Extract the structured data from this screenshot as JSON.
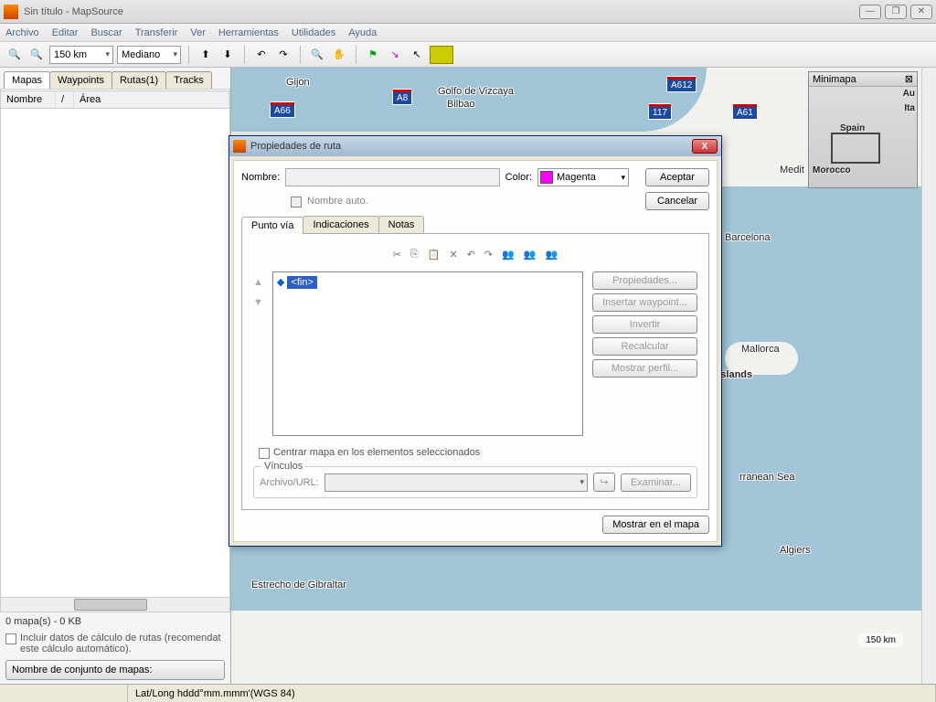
{
  "window": {
    "title": "Sin título - MapSource"
  },
  "menu": {
    "archivo": "Archivo",
    "editar": "Editar",
    "buscar": "Buscar",
    "transferir": "Transferir",
    "ver": "Ver",
    "herramientas": "Herramientas",
    "utilidades": "Utilidades",
    "ayuda": "Ayuda"
  },
  "toolbar": {
    "scale_sel": "150 km",
    "detail_sel": "Mediano"
  },
  "sidebar": {
    "tabs": {
      "mapas": "Mapas",
      "waypoints": "Waypoints",
      "rutas": "Rutas(1)",
      "tracks": "Tracks"
    },
    "cols": {
      "nombre": "Nombre",
      "sep": "/",
      "area": "Área"
    },
    "footer": "0 mapa(s) - 0 KB",
    "incluir": "Incluir datos de cálculo de rutas (recomendat este cálculo automático).",
    "mapset": "Nombre de conjunto de mapas:"
  },
  "map": {
    "labels": {
      "gijon": "Gijon",
      "golfo": "Golfo de Vizcaya",
      "bilbao": "Bilbao",
      "barcelona": "Barcelona",
      "mallorca": "Mallorca",
      "islands": "ic Islands",
      "medit_short": "Medit",
      "rranean": "rranean Sea",
      "algiers": "Algiers",
      "gibraltar": "Estrecho de Gibraltar"
    },
    "roads": {
      "a66": "A66",
      "a8": "A8",
      "a612": "A612",
      "r117": "117",
      "a61": "A61"
    },
    "scale": "150 km",
    "minimap": {
      "title": "Minimapa",
      "spain": "Spain",
      "morocco": "Morocco",
      "au": "Au",
      "ita": "Ita"
    }
  },
  "dialog": {
    "title": "Propiedades de ruta",
    "nombre_lbl": "Nombre:",
    "auto": "Nombre auto.",
    "color_lbl": "Color:",
    "color_val": "Magenta",
    "aceptar": "Aceptar",
    "cancelar": "Cancelar",
    "tabs": {
      "punto": "Punto vía",
      "indic": "Indicaciones",
      "notas": "Notas"
    },
    "fin": "<fin>",
    "btns": {
      "prop": "Propiedades...",
      "insert": "Insertar waypoint...",
      "invertir": "Invertir",
      "recalc": "Recalcular",
      "perfil": "Mostrar perfil..."
    },
    "centrar": "Centrar mapa en los elementos seleccionados",
    "vinculos": "Vínculos",
    "archivo_url": "Archivo/URL:",
    "examinar": "Examinar...",
    "mostrar": "Mostrar en el mapa"
  },
  "status": {
    "coords": "Lat/Long hddd°mm.mmm'(WGS 84)"
  }
}
